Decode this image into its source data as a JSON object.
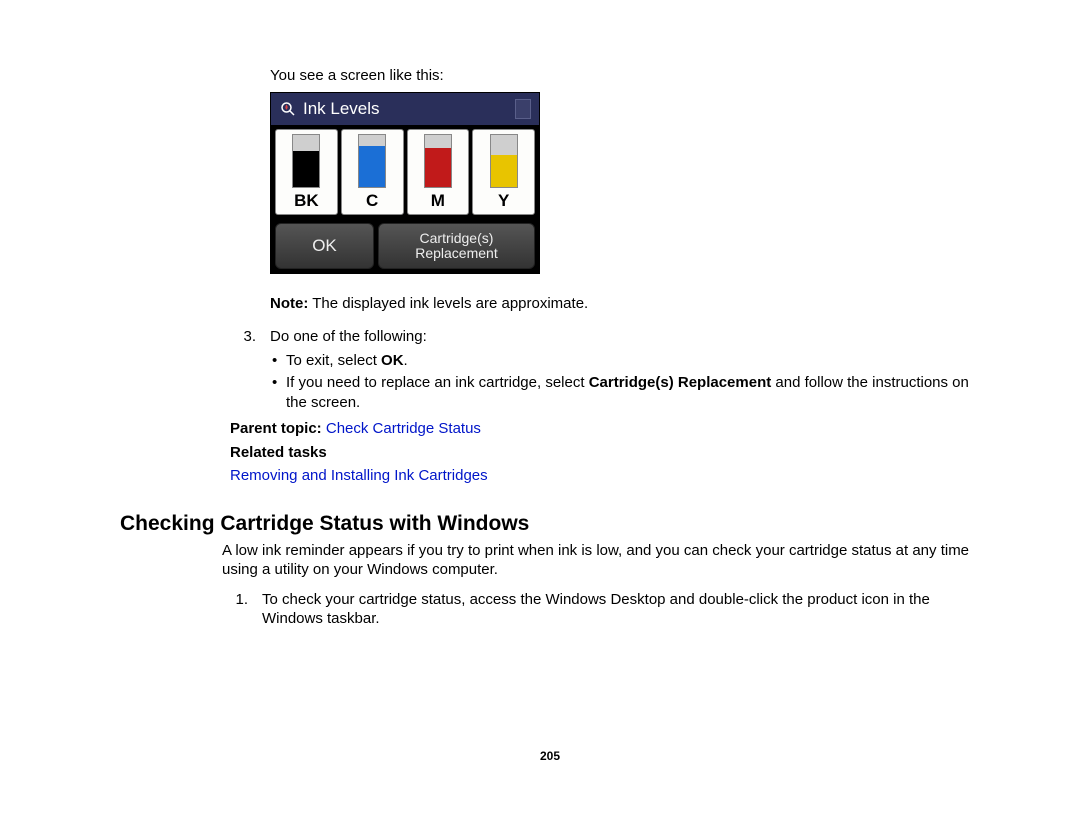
{
  "intro": "You see a screen like this:",
  "screen": {
    "title": "Ink Levels",
    "cartridges": [
      {
        "label": "BK",
        "color": "#000000",
        "levelPct": 68
      },
      {
        "label": "C",
        "color": "#1b6fd6",
        "levelPct": 78
      },
      {
        "label": "M",
        "color": "#c11a1a",
        "levelPct": 74
      },
      {
        "label": "Y",
        "color": "#e8c400",
        "levelPct": 60
      }
    ],
    "ok_label": "OK",
    "replace_label": "Cartridge(s) Replacement"
  },
  "note_prefix": "Note:",
  "note_text": " The displayed ink levels are approximate.",
  "step3": {
    "number": "3.",
    "intro": "Do one of the following:",
    "bullet1_pre": "To exit, select ",
    "bullet1_bold": "OK",
    "bullet1_post": ".",
    "bullet2_pre": "If you need to replace an ink cartridge, select ",
    "bullet2_bold": "Cartridge(s) Replacement",
    "bullet2_post": " and follow the instructions on the screen."
  },
  "parent_topic_label": "Parent topic:",
  "parent_topic_link": "Check Cartridge Status",
  "related_tasks_label": "Related tasks",
  "related_link": "Removing and Installing Ink Cartridges",
  "section_heading": "Checking Cartridge Status with Windows",
  "section_para": "A low ink reminder appears if you try to print when ink is low, and you can check your cartridge status at any time using a utility on your Windows computer.",
  "step1": {
    "number": "1.",
    "text": "To check your cartridge status, access the Windows Desktop and double-click the product icon in the Windows taskbar."
  },
  "page_number": "205"
}
